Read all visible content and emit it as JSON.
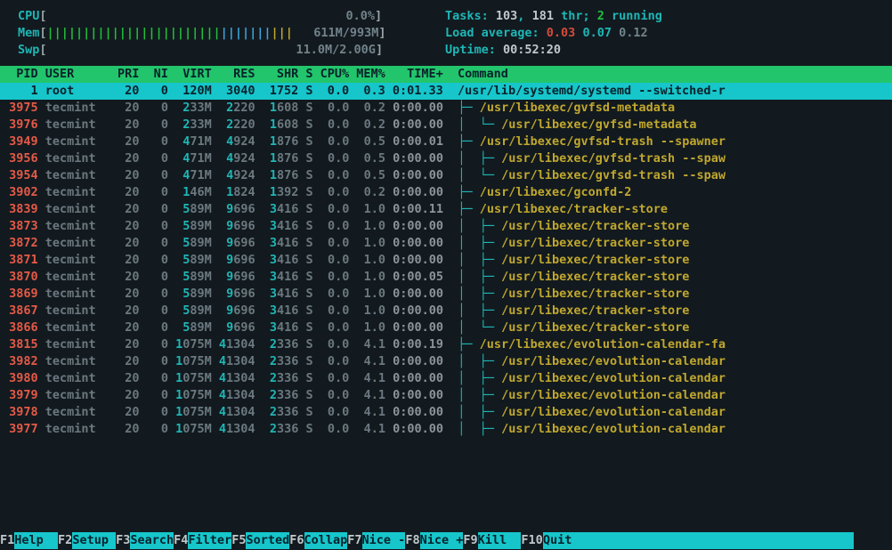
{
  "meters": {
    "cpu": {
      "label": "CPU",
      "bar": "",
      "value": "0.0%"
    },
    "mem": {
      "label": "Mem",
      "bar": "||||||||||||||||||||||||||||||||||",
      "value_used": "611M",
      "value_total": "993M"
    },
    "swp": {
      "label": "Swp",
      "bar": "",
      "value": "11.0M/2.00G"
    }
  },
  "info": {
    "tasks_label": "Tasks: ",
    "tasks": "103",
    "thr": "181",
    "thr_label": " thr; ",
    "running": "2",
    "running_label": " running",
    "load_label": "Load average: ",
    "l1": "0.03",
    "l5": "0.07",
    "l15": "0.12",
    "uptime_label": "Uptime: ",
    "uptime": "00:52:20"
  },
  "headers": "  PID USER      PRI  NI  VIRT   RES   SHR S CPU% MEM%   TIME+  Command",
  "selected": {
    "pid": "1",
    "user": "root",
    "pri": "20",
    "ni": "0",
    "virt": "120M",
    "res": "3040",
    "shr": "1752",
    "s": "S",
    "cpu": "0.0",
    "mem": "0.3",
    "time": "0:01.33",
    "cmd": "/usr/lib/systemd/systemd --switched-r"
  },
  "rows": [
    {
      "pid": "3975",
      "user": "tecmint",
      "pri": "20",
      "ni": "0",
      "virt": " 233M",
      "res": " 2220",
      "shr": "1608",
      "s": "S",
      "cpu": "0.0",
      "mem": "0.2",
      "time": "0:00.00",
      "tree": "├─ ",
      "cmd": "/usr/libexec/gvfsd-metadata"
    },
    {
      "pid": "3976",
      "user": "tecmint",
      "pri": "20",
      "ni": "0",
      "virt": " 233M",
      "res": " 2220",
      "shr": "1608",
      "s": "S",
      "cpu": "0.0",
      "mem": "0.2",
      "time": "0:00.00",
      "tree": "│  └─ ",
      "cmd": "/usr/libexec/gvfsd-metadata"
    },
    {
      "pid": "3949",
      "user": "tecmint",
      "pri": "20",
      "ni": "0",
      "virt": " 471M",
      "res": " 4924",
      "shr": "1876",
      "s": "S",
      "cpu": "0.0",
      "mem": "0.5",
      "time": "0:00.01",
      "tree": "├─ ",
      "cmd": "/usr/libexec/gvfsd-trash --spawner"
    },
    {
      "pid": "3956",
      "user": "tecmint",
      "pri": "20",
      "ni": "0",
      "virt": " 471M",
      "res": " 4924",
      "shr": "1876",
      "s": "S",
      "cpu": "0.0",
      "mem": "0.5",
      "time": "0:00.00",
      "tree": "│  ├─ ",
      "cmd": "/usr/libexec/gvfsd-trash --spaw"
    },
    {
      "pid": "3954",
      "user": "tecmint",
      "pri": "20",
      "ni": "0",
      "virt": " 471M",
      "res": " 4924",
      "shr": "1876",
      "s": "S",
      "cpu": "0.0",
      "mem": "0.5",
      "time": "0:00.00",
      "tree": "│  └─ ",
      "cmd": "/usr/libexec/gvfsd-trash --spaw"
    },
    {
      "pid": "3902",
      "user": "tecmint",
      "pri": "20",
      "ni": "0",
      "virt": " 146M",
      "res": " 1824",
      "shr": "1392",
      "s": "S",
      "cpu": "0.0",
      "mem": "0.2",
      "time": "0:00.00",
      "tree": "├─ ",
      "cmd": "/usr/libexec/gconfd-2"
    },
    {
      "pid": "3839",
      "user": "tecmint",
      "pri": "20",
      "ni": "0",
      "virt": " 589M",
      "res": " 9696",
      "shr": "3416",
      "s": "S",
      "cpu": "0.0",
      "mem": "1.0",
      "time": "0:00.11",
      "tree": "├─ ",
      "cmd": "/usr/libexec/tracker-store"
    },
    {
      "pid": "3873",
      "user": "tecmint",
      "pri": "20",
      "ni": "0",
      "virt": " 589M",
      "res": " 9696",
      "shr": "3416",
      "s": "S",
      "cpu": "0.0",
      "mem": "1.0",
      "time": "0:00.00",
      "tree": "│  ├─ ",
      "cmd": "/usr/libexec/tracker-store"
    },
    {
      "pid": "3872",
      "user": "tecmint",
      "pri": "20",
      "ni": "0",
      "virt": " 589M",
      "res": " 9696",
      "shr": "3416",
      "s": "S",
      "cpu": "0.0",
      "mem": "1.0",
      "time": "0:00.00",
      "tree": "│  ├─ ",
      "cmd": "/usr/libexec/tracker-store"
    },
    {
      "pid": "3871",
      "user": "tecmint",
      "pri": "20",
      "ni": "0",
      "virt": " 589M",
      "res": " 9696",
      "shr": "3416",
      "s": "S",
      "cpu": "0.0",
      "mem": "1.0",
      "time": "0:00.00",
      "tree": "│  ├─ ",
      "cmd": "/usr/libexec/tracker-store"
    },
    {
      "pid": "3870",
      "user": "tecmint",
      "pri": "20",
      "ni": "0",
      "virt": " 589M",
      "res": " 9696",
      "shr": "3416",
      "s": "S",
      "cpu": "0.0",
      "mem": "1.0",
      "time": "0:00.05",
      "tree": "│  ├─ ",
      "cmd": "/usr/libexec/tracker-store"
    },
    {
      "pid": "3869",
      "user": "tecmint",
      "pri": "20",
      "ni": "0",
      "virt": " 589M",
      "res": " 9696",
      "shr": "3416",
      "s": "S",
      "cpu": "0.0",
      "mem": "1.0",
      "time": "0:00.00",
      "tree": "│  ├─ ",
      "cmd": "/usr/libexec/tracker-store"
    },
    {
      "pid": "3867",
      "user": "tecmint",
      "pri": "20",
      "ni": "0",
      "virt": " 589M",
      "res": " 9696",
      "shr": "3416",
      "s": "S",
      "cpu": "0.0",
      "mem": "1.0",
      "time": "0:00.00",
      "tree": "│  ├─ ",
      "cmd": "/usr/libexec/tracker-store"
    },
    {
      "pid": "3866",
      "user": "tecmint",
      "pri": "20",
      "ni": "0",
      "virt": " 589M",
      "res": " 9696",
      "shr": "3416",
      "s": "S",
      "cpu": "0.0",
      "mem": "1.0",
      "time": "0:00.00",
      "tree": "│  └─ ",
      "cmd": "/usr/libexec/tracker-store"
    },
    {
      "pid": "3815",
      "user": "tecmint",
      "pri": "20",
      "ni": "0",
      "virt": "1075M",
      "res": "41304",
      "shr": "2336",
      "s": "S",
      "cpu": "0.0",
      "mem": "4.1",
      "time": "0:00.19",
      "tree": "├─ ",
      "cmd": "/usr/libexec/evolution-calendar-fa"
    },
    {
      "pid": "3982",
      "user": "tecmint",
      "pri": "20",
      "ni": "0",
      "virt": "1075M",
      "res": "41304",
      "shr": "2336",
      "s": "S",
      "cpu": "0.0",
      "mem": "4.1",
      "time": "0:00.00",
      "tree": "│  ├─ ",
      "cmd": "/usr/libexec/evolution-calendar"
    },
    {
      "pid": "3980",
      "user": "tecmint",
      "pri": "20",
      "ni": "0",
      "virt": "1075M",
      "res": "41304",
      "shr": "2336",
      "s": "S",
      "cpu": "0.0",
      "mem": "4.1",
      "time": "0:00.00",
      "tree": "│  ├─ ",
      "cmd": "/usr/libexec/evolution-calendar"
    },
    {
      "pid": "3979",
      "user": "tecmint",
      "pri": "20",
      "ni": "0",
      "virt": "1075M",
      "res": "41304",
      "shr": "2336",
      "s": "S",
      "cpu": "0.0",
      "mem": "4.1",
      "time": "0:00.00",
      "tree": "│  ├─ ",
      "cmd": "/usr/libexec/evolution-calendar"
    },
    {
      "pid": "3978",
      "user": "tecmint",
      "pri": "20",
      "ni": "0",
      "virt": "1075M",
      "res": "41304",
      "shr": "2336",
      "s": "S",
      "cpu": "0.0",
      "mem": "4.1",
      "time": "0:00.00",
      "tree": "│  ├─ ",
      "cmd": "/usr/libexec/evolution-calendar"
    },
    {
      "pid": "3977",
      "user": "tecmint",
      "pri": "20",
      "ni": "0",
      "virt": "1075M",
      "res": "41304",
      "shr": "2336",
      "s": "S",
      "cpu": "0.0",
      "mem": "4.1",
      "time": "0:00.00",
      "tree": "│  ├─ ",
      "cmd": "/usr/libexec/evolution-calendar"
    }
  ],
  "fkeys": [
    {
      "key": "F1",
      "label": "Help  "
    },
    {
      "key": "F2",
      "label": "Setup "
    },
    {
      "key": "F3",
      "label": "Search"
    },
    {
      "key": "F4",
      "label": "Filter"
    },
    {
      "key": "F5",
      "label": "Sorted"
    },
    {
      "key": "F6",
      "label": "Collap"
    },
    {
      "key": "F7",
      "label": "Nice -"
    },
    {
      "key": "F8",
      "label": "Nice +"
    },
    {
      "key": "F9",
      "label": "Kill  "
    },
    {
      "key": "F10",
      "label": "Quit  "
    }
  ]
}
